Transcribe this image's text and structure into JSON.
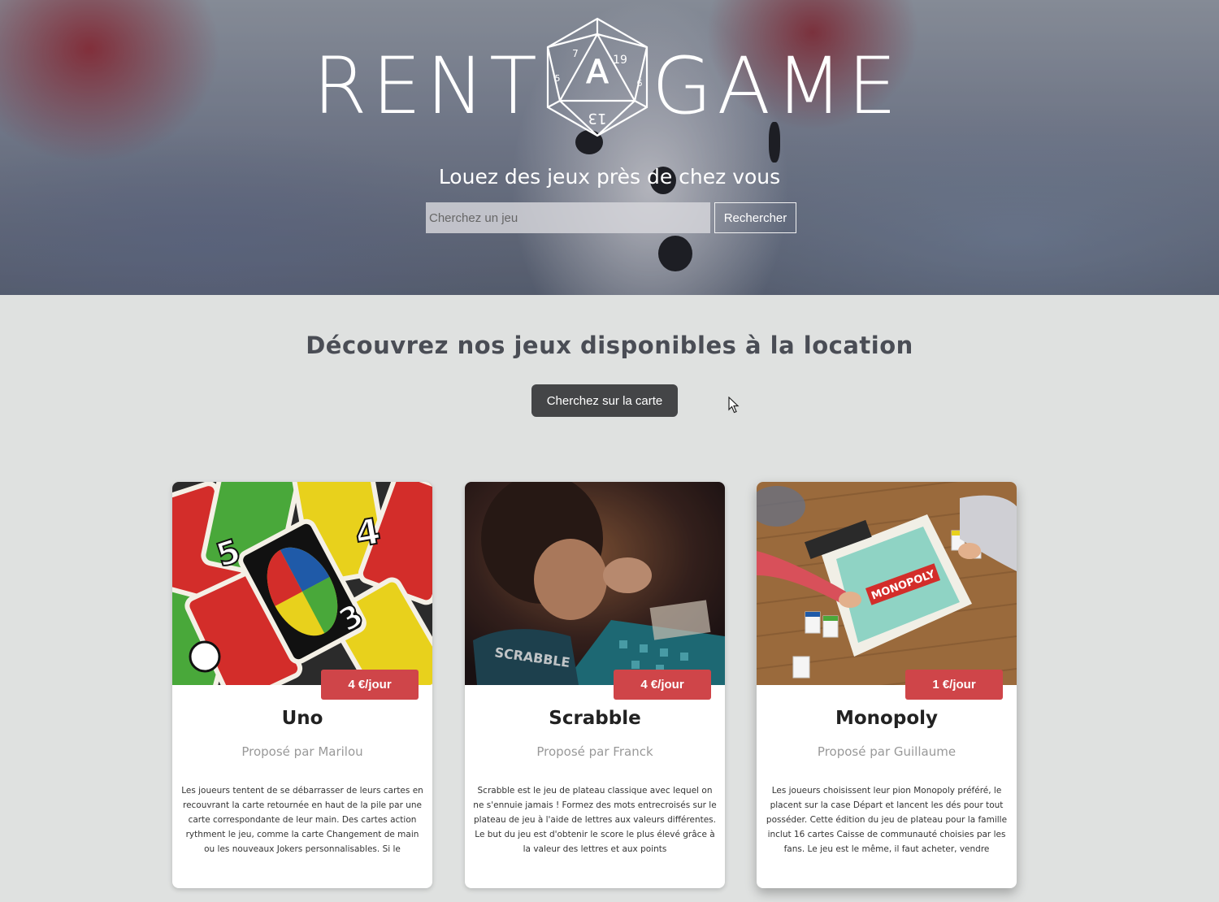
{
  "brand": {
    "left": "RENT",
    "middle": "A",
    "right": "GAME"
  },
  "hero": {
    "tagline": "Louez des jeux près de chez vous",
    "search_placeholder": "Cherchez un jeu",
    "search_button": "Rechercher"
  },
  "main": {
    "title": "Découvrez nos jeux disponibles à la location",
    "map_button": "Cherchez sur la carte"
  },
  "games": [
    {
      "title": "Uno",
      "price": "4 €/jour",
      "owner": "Proposé par Marilou",
      "description": "Les joueurs tentent de se débarrasser de leurs cartes en recouvrant la carte retournée en haut de la pile par une carte correspondante de leur main. Des cartes action rythment le jeu, comme la carte Changement de main ou les nouveaux Jokers personnalisables. Si le"
    },
    {
      "title": "Scrabble",
      "price": "4 €/jour",
      "owner": "Proposé par Franck",
      "description": "Scrabble est le jeu de plateau classique avec lequel on ne s'ennuie jamais ! Formez des mots entrecroisés sur le plateau de jeu à l'aide de lettres aux valeurs différentes. Le but du jeu est d'obtenir le score le plus élevé grâce à la valeur des lettres et aux points"
    },
    {
      "title": "Monopoly",
      "price": "1 €/jour",
      "owner": "Proposé par Guillaume",
      "description": "Les joueurs choisissent leur pion Monopoly préféré, le placent sur la case Départ et lancent les dés pour tout posséder. Cette édition du jeu de plateau pour la famille inclut 16 cartes Caisse de communauté choisies par les fans. Le jeu est le même, il faut acheter, vendre"
    }
  ],
  "colors": {
    "price_badge": "#cf4549",
    "page_bg": "#dfe1e0",
    "map_button_bg": "#444547"
  }
}
